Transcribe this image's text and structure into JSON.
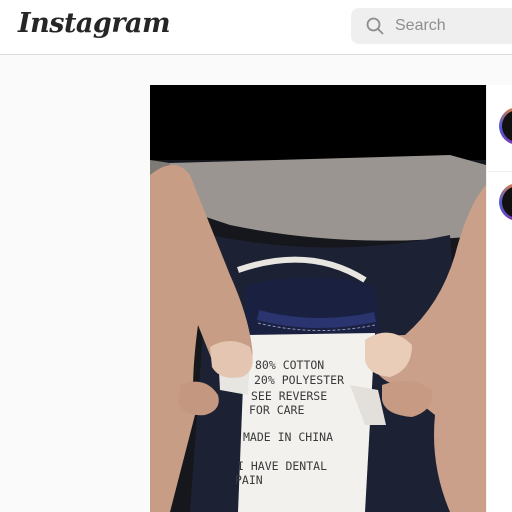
{
  "header": {
    "logo_text": "Instagram"
  },
  "search": {
    "placeholder": "Search"
  },
  "post": {
    "label_lines": [
      "80% COTTON",
      "20% POLYESTER",
      "SEE REVERSE",
      "FOR CARE",
      "MADE IN CHINA",
      "I HAVE DENTAL",
      "PAIN"
    ]
  },
  "colors": {
    "brand_text": "#262626",
    "search_bg": "#efefef",
    "placeholder": "#8e8e8e",
    "divider": "#dbdbdb"
  }
}
